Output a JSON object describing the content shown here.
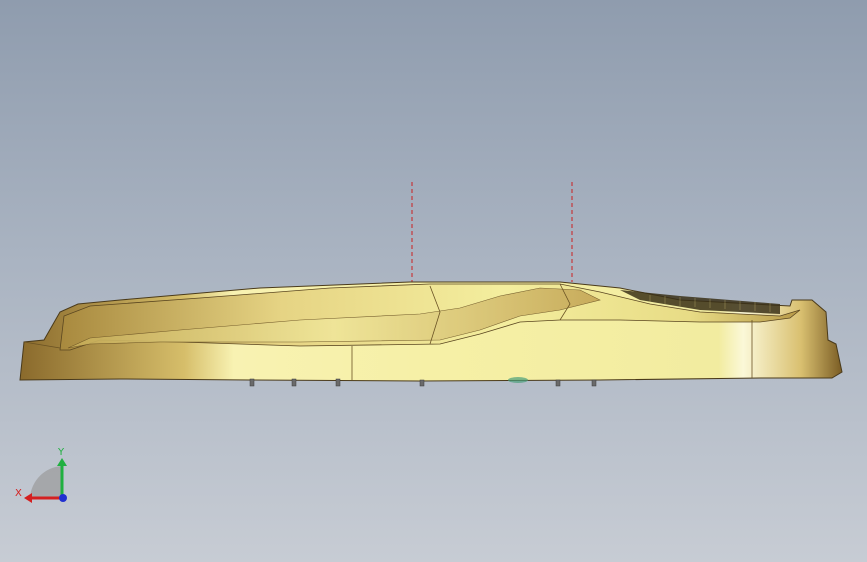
{
  "viewport": {
    "background_top": "#8f9cae",
    "background_bottom": "#c7ccd4"
  },
  "model": {
    "body_light": "#f4eea0",
    "body_mid": "#d8c46a",
    "body_dark": "#8a6a2c",
    "edge": "#4a3a1a",
    "center_line_color": "#cc2020"
  },
  "triad": {
    "x_label": "X",
    "y_label": "Y",
    "x_color": "#d42020",
    "y_color": "#20b040",
    "z_color": "#2030d0"
  }
}
